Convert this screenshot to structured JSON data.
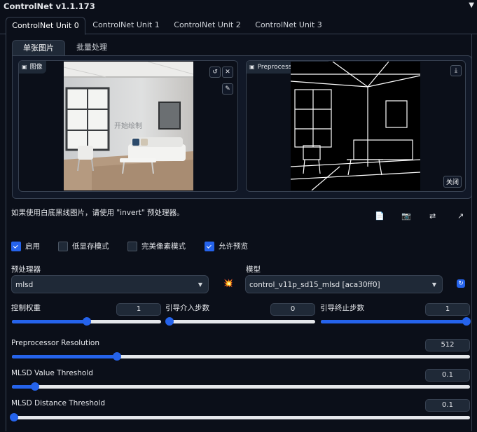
{
  "header": {
    "title": "ControlNet v1.1.173",
    "collapse_icon": "▼"
  },
  "tabs": [
    "ControlNet Unit 0",
    "ControlNet Unit 1",
    "ControlNet Unit 2",
    "ControlNet Unit 3"
  ],
  "subtabs": [
    "单张图片",
    "批量处理"
  ],
  "image_box": {
    "label": "图像",
    "overlay_text": "开始绘制"
  },
  "preview_box": {
    "label": "Preprocessor Preview",
    "close_label": "关闭"
  },
  "hint": "如果使用白底黑线图片，请使用 \"invert\" 预处理器。",
  "checkboxes": [
    {
      "label": "启用",
      "checked": true
    },
    {
      "label": "低显存模式",
      "checked": false
    },
    {
      "label": "完美像素模式",
      "checked": false
    },
    {
      "label": "允许预览",
      "checked": true
    }
  ],
  "preprocessor": {
    "label": "预处理器",
    "value": "mlsd"
  },
  "model": {
    "label": "模型",
    "value": "control_v11p_sd15_mlsd [aca30ff0]"
  },
  "sliders": {
    "control_weight": {
      "label": "控制权重",
      "value": "1",
      "fraction": 0.5
    },
    "start_step": {
      "label": "引导介入步数",
      "value": "0",
      "fraction": 0.0
    },
    "end_step": {
      "label": "引导终止步数",
      "value": "1",
      "fraction": 1.0
    },
    "resolution": {
      "label": "Preprocessor Resolution",
      "value": "512",
      "fraction": 0.23
    },
    "value_threshold": {
      "label": "MLSD Value Threshold",
      "value": "0.1",
      "fraction": 0.05
    },
    "distance_threshold": {
      "label": "MLSD Distance Threshold",
      "value": "0.1",
      "fraction": 0.005
    }
  }
}
